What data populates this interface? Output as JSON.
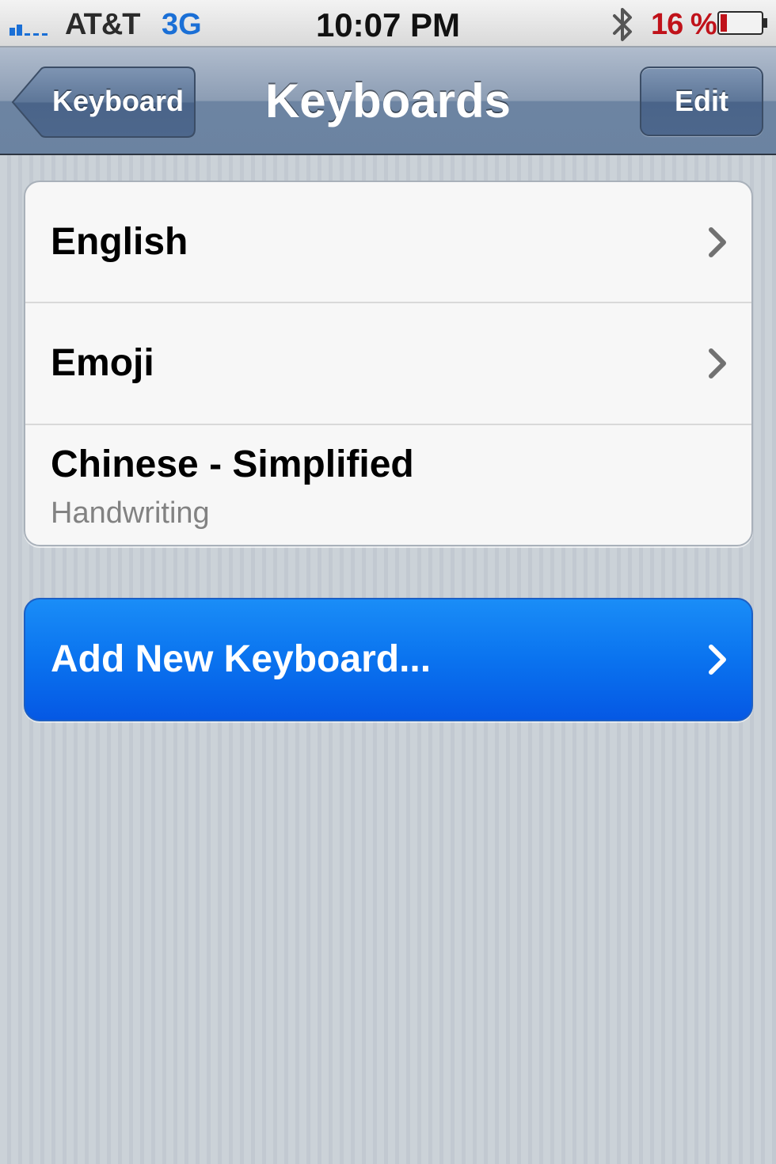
{
  "status_bar": {
    "carrier": "AT&T",
    "network": "3G",
    "time": "10:07 PM",
    "battery_percent": "16 %",
    "signal_icon": "signal-bars-icon",
    "bluetooth_icon": "bluetooth-icon",
    "battery_icon": "battery-icon",
    "battery_level": 0.16,
    "battery_color": "#c0121a",
    "network_color": "#1a6fd6"
  },
  "nav_bar": {
    "back_label": "Keyboard",
    "title": "Keyboards",
    "edit_label": "Edit"
  },
  "keyboards": [
    {
      "label": "English",
      "sublabel": "",
      "has_chevron": true
    },
    {
      "label": "Emoji",
      "sublabel": "",
      "has_chevron": true
    },
    {
      "label": "Chinese - Simplified",
      "sublabel": "Handwriting",
      "has_chevron": false
    }
  ],
  "add_button": {
    "label": "Add New Keyboard...",
    "icon": "chevron-right-icon",
    "color": "#0a73ef"
  }
}
